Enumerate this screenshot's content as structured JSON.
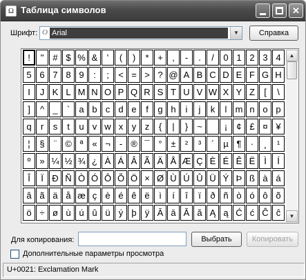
{
  "window": {
    "title": "Таблица символов",
    "icon": "charmap-app-icon"
  },
  "font": {
    "label": "Шрифт:",
    "value": "Arial",
    "help_label": "Справка"
  },
  "chars": [
    "!",
    "\"",
    "#",
    "$",
    "%",
    "&",
    "'",
    "(",
    ")",
    "*",
    "+",
    ",",
    "-",
    ".",
    "/",
    "0",
    "1",
    "2",
    "3",
    "4",
    "5",
    "6",
    "7",
    "8",
    "9",
    ":",
    ";",
    "<",
    "=",
    ">",
    "?",
    "@",
    "A",
    "B",
    "C",
    "D",
    "E",
    "F",
    "G",
    "H",
    "I",
    "J",
    "K",
    "L",
    "M",
    "N",
    "O",
    "P",
    "Q",
    "R",
    "S",
    "T",
    "U",
    "V",
    "W",
    "X",
    "Y",
    "Z",
    "[",
    "\\",
    "]",
    "^",
    "_",
    "`",
    "a",
    "b",
    "c",
    "d",
    "e",
    "f",
    "g",
    "h",
    "i",
    "j",
    "k",
    "l",
    "m",
    "n",
    "o",
    "p",
    "q",
    "r",
    "s",
    "t",
    "u",
    "v",
    "w",
    "x",
    "y",
    "z",
    "{",
    "|",
    "}",
    "~",
    " ",
    "¡",
    "¢",
    "£",
    "¤",
    "¥",
    "¦",
    "§",
    "¨",
    "©",
    "ª",
    "«",
    "¬",
    "-",
    "®",
    "¯",
    "°",
    "±",
    "²",
    "³",
    "´",
    "µ",
    "¶",
    "·",
    "¸",
    "¹",
    "º",
    "»",
    "¼",
    "½",
    "¾",
    "¿",
    "À",
    "Á",
    "Â",
    "Ã",
    "Ä",
    "Å",
    "Æ",
    "Ç",
    "È",
    "É",
    "Ê",
    "Ë",
    "Ì",
    "Í",
    "Î",
    "Ï",
    "Ð",
    "Ñ",
    "Ò",
    "Ó",
    "Ô",
    "Õ",
    "Ö",
    "×",
    "Ø",
    "Ù",
    "Ú",
    "Û",
    "Ü",
    "Ý",
    "Þ",
    "ß",
    "à",
    "á",
    "â",
    "ã",
    "ä",
    "å",
    "æ",
    "ç",
    "è",
    "é",
    "ê",
    "ë",
    "ì",
    "í",
    "î",
    "ï",
    "ð",
    "ñ",
    "ò",
    "ó",
    "ô",
    "õ",
    "ö",
    "÷",
    "ø",
    "ù",
    "ú",
    "û",
    "ü",
    "ý",
    "þ",
    "ÿ",
    "Ā",
    "ā",
    "Ă",
    "ă",
    "Ą",
    "ą",
    "Ć",
    "ć",
    "Ĉ",
    "ĉ"
  ],
  "selected_index": 0,
  "copy": {
    "label": "Для копирования:",
    "value": "",
    "choose_label": "Выбрать",
    "copy_label": "Копировать"
  },
  "advanced": {
    "label": "Дополнительные параметры просмотра",
    "checked": false
  },
  "status": "U+0021: Exclamation Mark"
}
